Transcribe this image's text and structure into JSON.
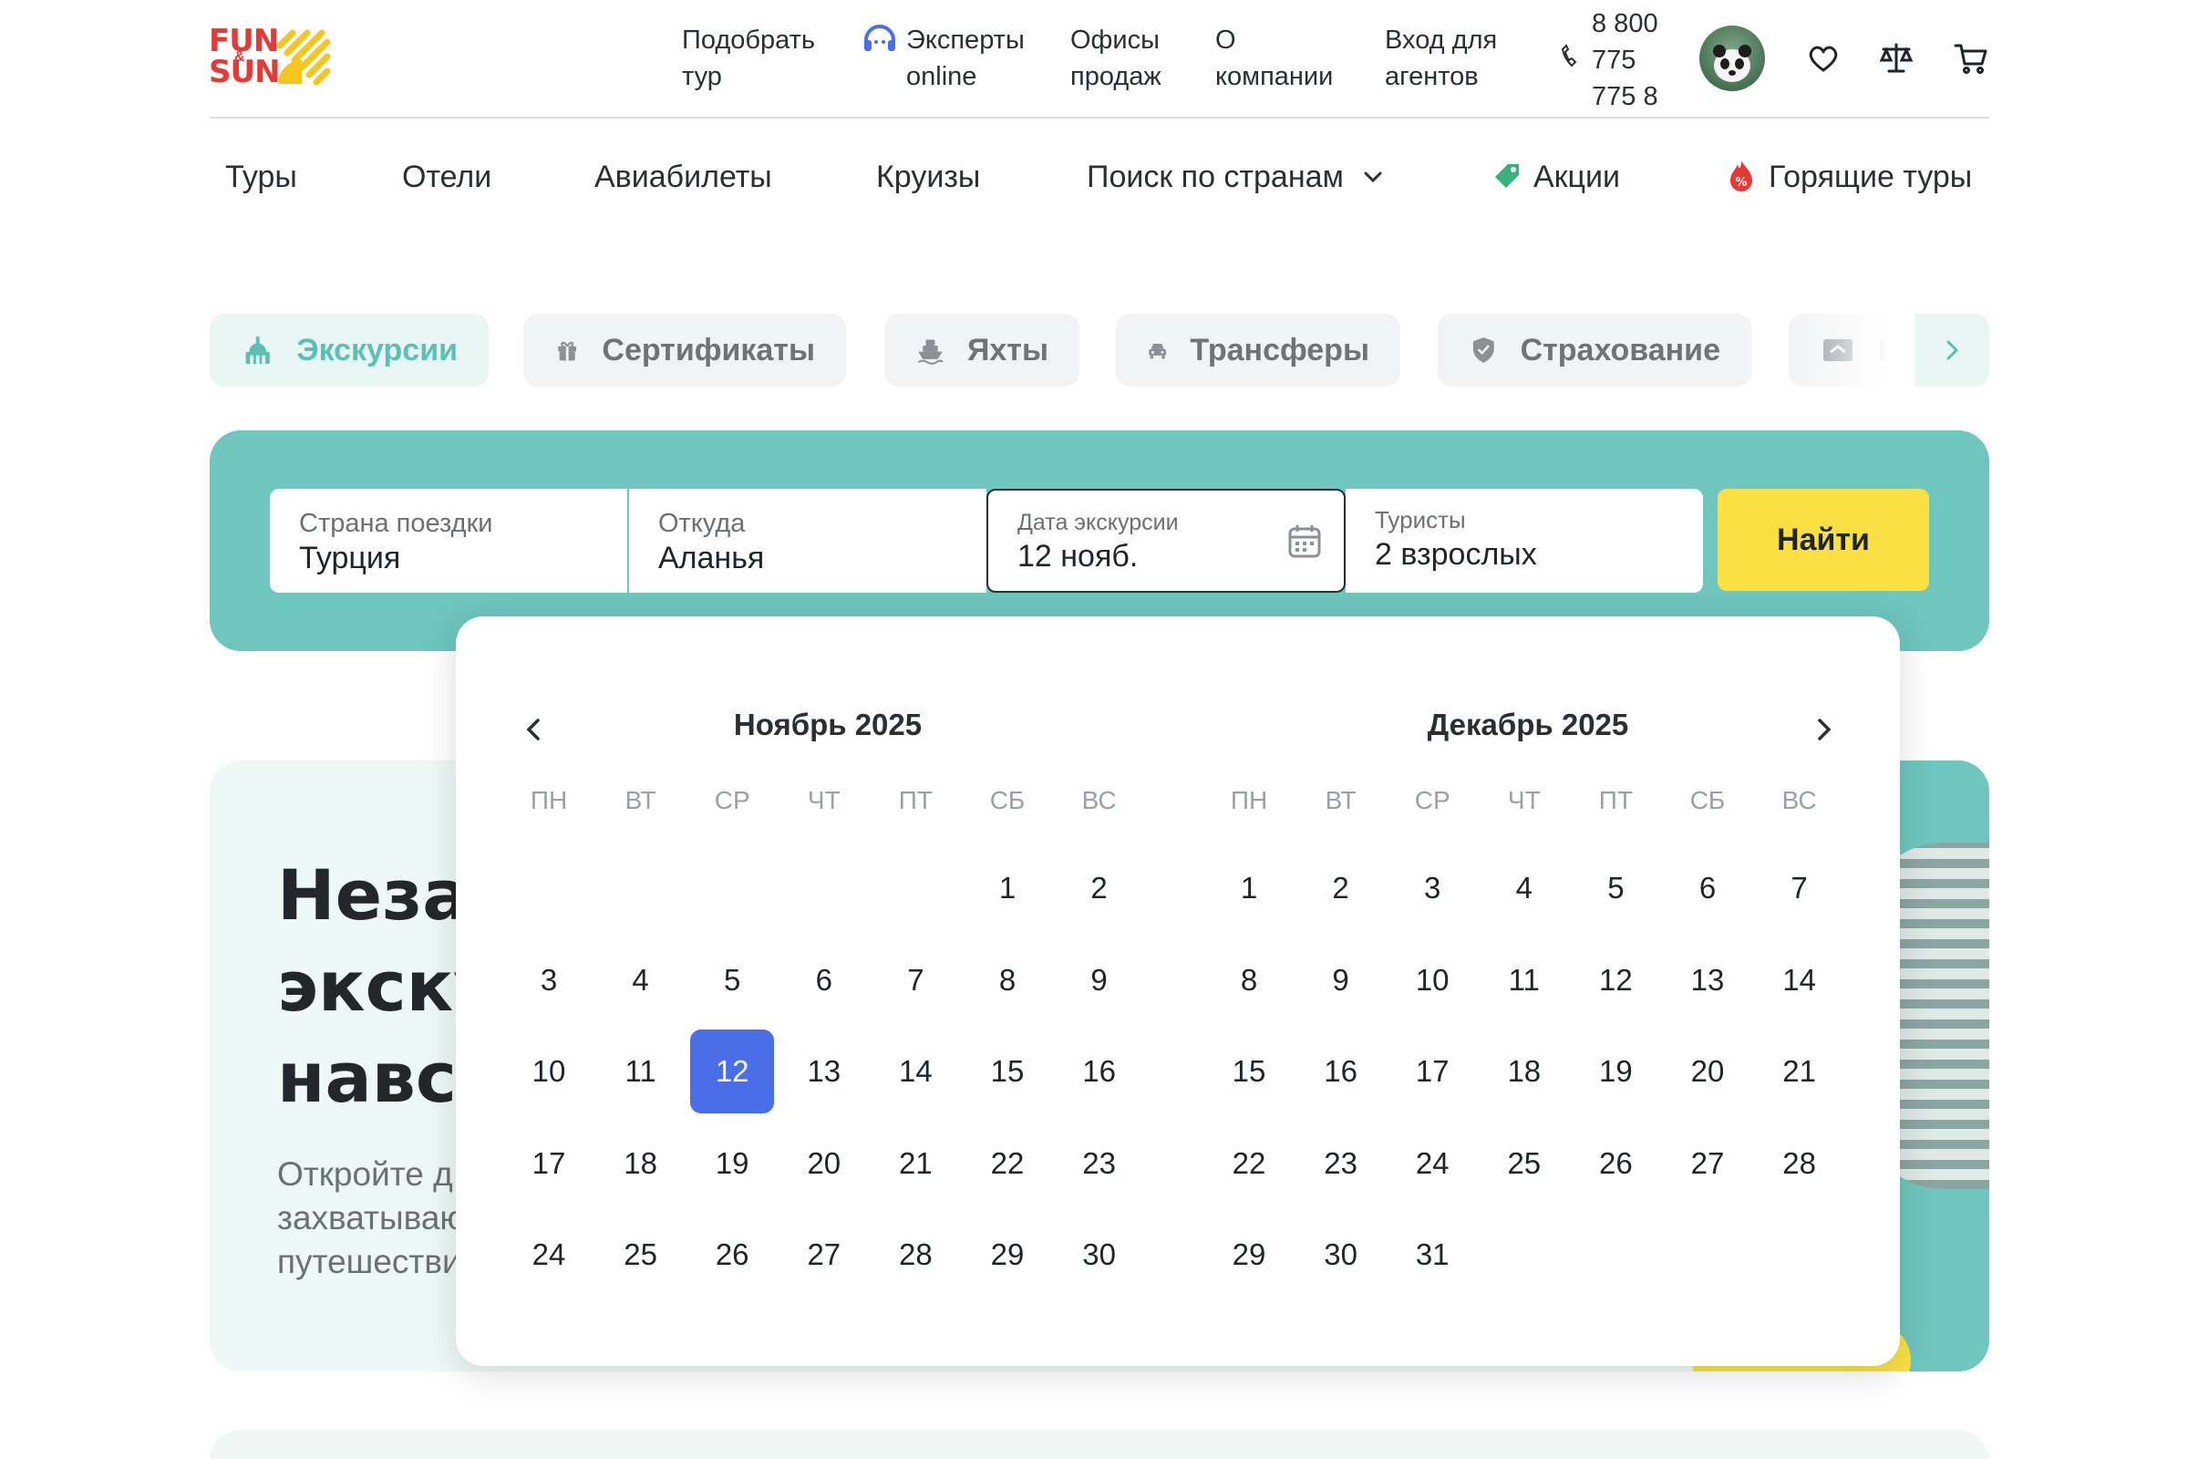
{
  "header": {
    "logo_text_line1": "FUN",
    "logo_text_amp": "&",
    "logo_text_line2": "SUN",
    "nav": {
      "pick_tour": "Подобрать\nтур",
      "experts": "Эксперты\nonline",
      "offices": "Офисы\nпродаж",
      "about": "О\nкомпании",
      "agents": "Вход для\nагентов",
      "phone": "8 800\n775\n775 8"
    },
    "icons": [
      "headset-icon",
      "phone-icon",
      "heart-icon",
      "scales-icon",
      "cart-icon"
    ]
  },
  "main_nav": {
    "tours": "Туры",
    "hotels": "Отели",
    "flights": "Авиабилеты",
    "cruises": "Круизы",
    "countries": "Поиск по странам",
    "promo": "Акции",
    "hot": "Горящие туры"
  },
  "categories": {
    "excursions": "Экскурсии",
    "certificates": "Сертификаты",
    "yachts": "Яхты",
    "transfers": "Трансферы",
    "insurance": "Страхование",
    "partial": "В"
  },
  "search": {
    "country_label": "Страна поездки",
    "country_value": "Турция",
    "from_label": "Откуда",
    "from_value": "Аланья",
    "date_label": "Дата экскурсии",
    "date_value": "12 нояб.",
    "tourists_label": "Туристы",
    "tourists_value": "2 взрослых",
    "find_button": "Найти"
  },
  "hero": {
    "title_line1": "Незаб",
    "title_line2": "экску",
    "title_line3": "навсе",
    "sub_line1": "Откройте д",
    "sub_line2": "захватываю",
    "sub_line3": "путешестви"
  },
  "calendar": {
    "weekdays": [
      "ПН",
      "ВТ",
      "СР",
      "ЧТ",
      "ПТ",
      "СБ",
      "ВС"
    ],
    "months": [
      {
        "title": "Ноябрь 2025",
        "first_weekday_index": 5,
        "days": 30,
        "selected_day": 12
      },
      {
        "title": "Декабрь 2025",
        "first_weekday_index": 0,
        "days": 31,
        "selected_day": null
      }
    ]
  },
  "colors": {
    "teal": "#6ec6be",
    "accent_red": "#e53935",
    "yellow": "#fbe043",
    "selected_blue": "#4a6ee8"
  }
}
